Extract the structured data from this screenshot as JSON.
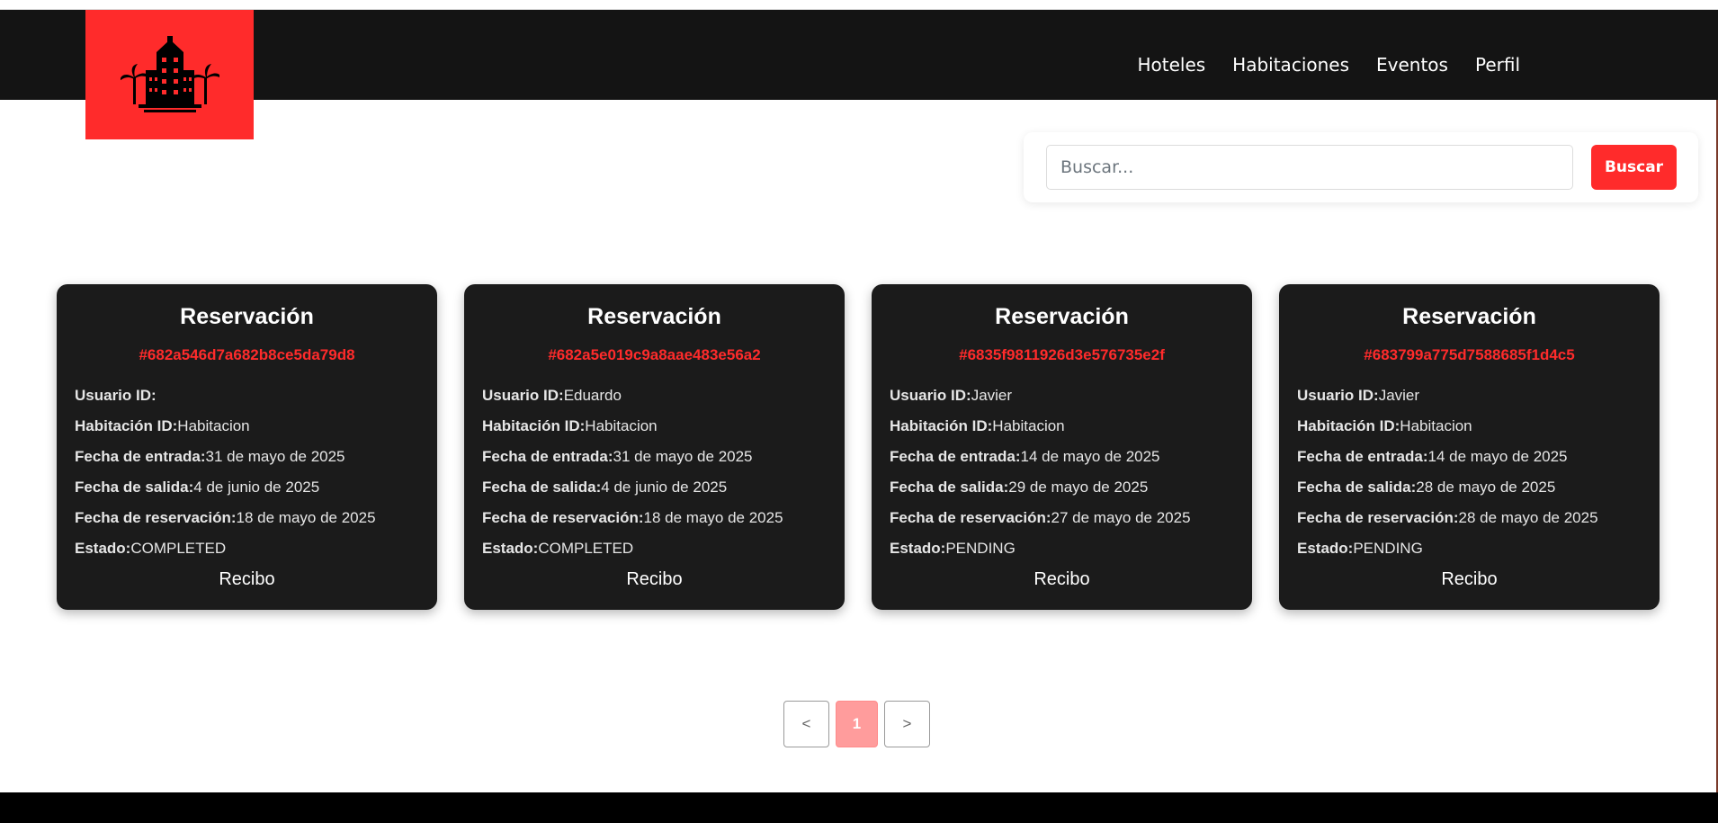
{
  "nav": {
    "links": [
      "Hoteles",
      "Habitaciones",
      "Eventos",
      "Perfil"
    ],
    "logo_icon": "hotel-buildings-palms-icon"
  },
  "search": {
    "placeholder": "Buscar...",
    "value": "",
    "button_label": "Buscar"
  },
  "colors": {
    "brand": "#ff2b2b",
    "navbar": "#141414",
    "card": "#1b1b1b"
  },
  "labels": {
    "user": "Usuario ID:",
    "room": "Habitación ID:",
    "checkin": "Fecha de entrada:",
    "checkout": "Fecha de salida:",
    "booked": "Fecha de reservación:",
    "status": "Estado:"
  },
  "reservations": [
    {
      "title": "Reservación",
      "id": "#682a546d7a682b8ce5da79d8",
      "user": "",
      "room": "Habitacion",
      "checkin": "31 de mayo de 2025",
      "checkout": "4 de junio de 2025",
      "booked": "18 de mayo de 2025",
      "status": "COMPLETED",
      "receipt": "Recibo"
    },
    {
      "title": "Reservación",
      "id": "#682a5e019c9a8aae483e56a2",
      "user": "Eduardo",
      "room": "Habitacion",
      "checkin": "31 de mayo de 2025",
      "checkout": "4 de junio de 2025",
      "booked": "18 de mayo de 2025",
      "status": "COMPLETED",
      "receipt": "Recibo"
    },
    {
      "title": "Reservación",
      "id": "#6835f9811926d3e576735e2f",
      "user": "Javier",
      "room": "Habitacion",
      "checkin": "14 de mayo de 2025",
      "checkout": "29 de mayo de 2025",
      "booked": "27 de mayo de 2025",
      "status": "PENDING",
      "receipt": "Recibo"
    },
    {
      "title": "Reservación",
      "id": "#683799a775d7588685f1d4c5",
      "user": "Javier",
      "room": "Habitacion",
      "checkin": "14 de mayo de 2025",
      "checkout": "28 de mayo de 2025",
      "booked": "28 de mayo de 2025",
      "status": "PENDING",
      "receipt": "Recibo"
    }
  ],
  "pagination": {
    "prev": "<",
    "current": "1",
    "next": ">"
  }
}
